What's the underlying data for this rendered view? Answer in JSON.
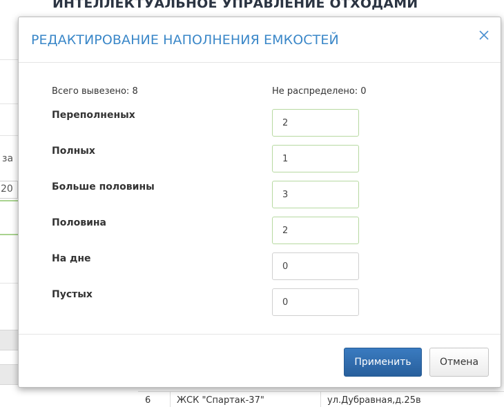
{
  "background": {
    "page_title": "ИНТЕЛЛЕКТУАЛЬНОЕ УПРАВЛЕНИЕ ОТХОДАМИ",
    "cut_label": "за",
    "cut_value": "20",
    "table_row": {
      "number": "6",
      "name": "ЖСК \"Спартак-37\"",
      "address": "ул.Дубравная,д.25в"
    }
  },
  "modal": {
    "title": "РЕДАКТИРОВАНИЕ НАПОЛНЕНИЯ ЕМКОСТЕЙ",
    "close_icon": "close-icon",
    "total_taken": "Всего вывезено: 8",
    "not_distributed": "Не распределено: 0",
    "fields": [
      {
        "label": "Переполненых",
        "value": "2"
      },
      {
        "label": "Полных",
        "value": "1"
      },
      {
        "label": "Больше половины",
        "value": "3"
      },
      {
        "label": "Половина",
        "value": "2"
      },
      {
        "label": "На дне",
        "value": "0"
      },
      {
        "label": "Пустых",
        "value": "0"
      }
    ],
    "apply_label": "Применить",
    "cancel_label": "Отмена"
  },
  "colors": {
    "title_blue": "#3a87c8",
    "primary_button": "#2e6aa8",
    "filled_input_border": "#b6d9a0"
  }
}
